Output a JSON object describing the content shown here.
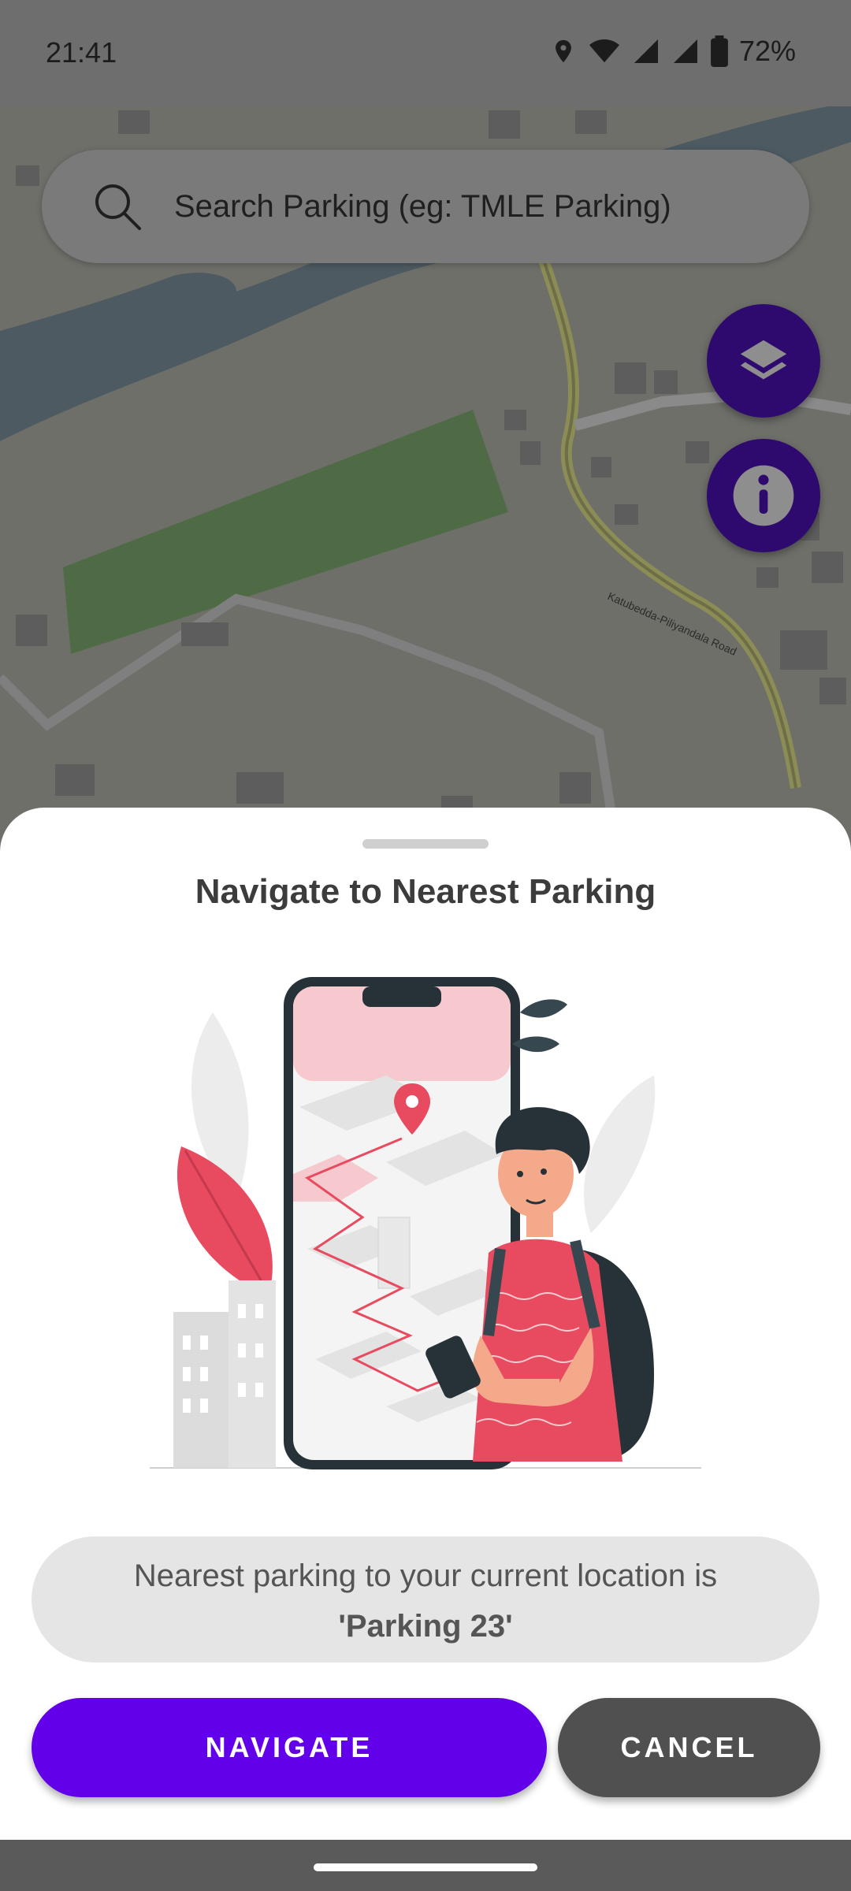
{
  "status_bar": {
    "time": "21:41",
    "battery": "72%",
    "icons": [
      "location-icon",
      "wifi-icon",
      "signal-icon",
      "signal-icon",
      "battery-icon"
    ]
  },
  "search": {
    "placeholder": "Search Parking (eg: TMLE Parking)",
    "icon": "search-icon"
  },
  "map": {
    "road_label": "Katubedda-Piliyandala Road",
    "fabs": [
      {
        "icon": "layers-icon",
        "color": "#2f0a6e"
      },
      {
        "icon": "info-icon",
        "color": "#2f0a6e"
      }
    ]
  },
  "sheet": {
    "title": "Navigate to Nearest Parking",
    "message_line1": "Nearest parking to your current location is",
    "message_line2": "'Parking 23'",
    "navigate_label": "NAVIGATE",
    "cancel_label": "CANCEL",
    "colors": {
      "primary": "#6200ea",
      "secondary": "#505050",
      "accent": "#e84a5f"
    }
  }
}
